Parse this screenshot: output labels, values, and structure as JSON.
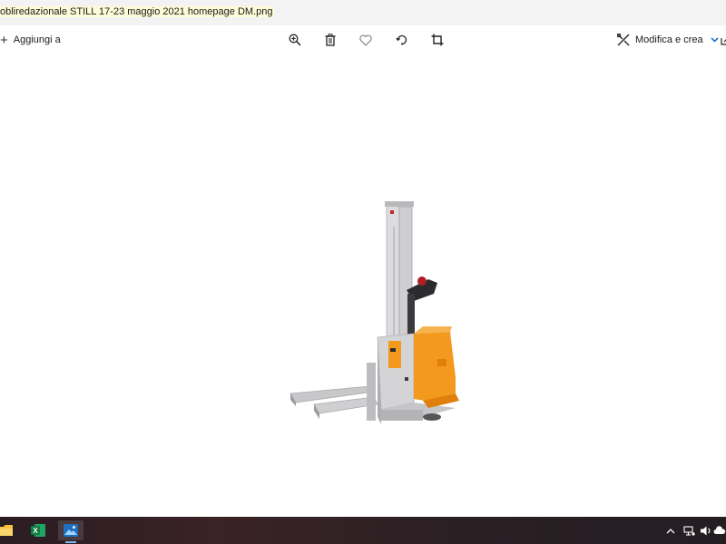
{
  "window": {
    "title": "obliredazionale STILL 17-23 maggio 2021 homepage DM.png"
  },
  "toolbar": {
    "add_label": "Aggiungi a",
    "edit_label": "Modifica e crea",
    "icons": [
      "zoom-in-icon",
      "delete-icon",
      "heart-icon",
      "rotate-icon",
      "crop-icon"
    ]
  },
  "image": {
    "subject": "forklift-stacker",
    "accent_color": "#f39a1e",
    "body_color": "#c9c9cb"
  },
  "taskbar": {
    "apps": [
      "file-explorer-icon",
      "excel-icon",
      "photos-icon"
    ],
    "tray": [
      "chevron-up-icon",
      "network-icon",
      "sound-icon",
      "cloud-icon"
    ]
  }
}
